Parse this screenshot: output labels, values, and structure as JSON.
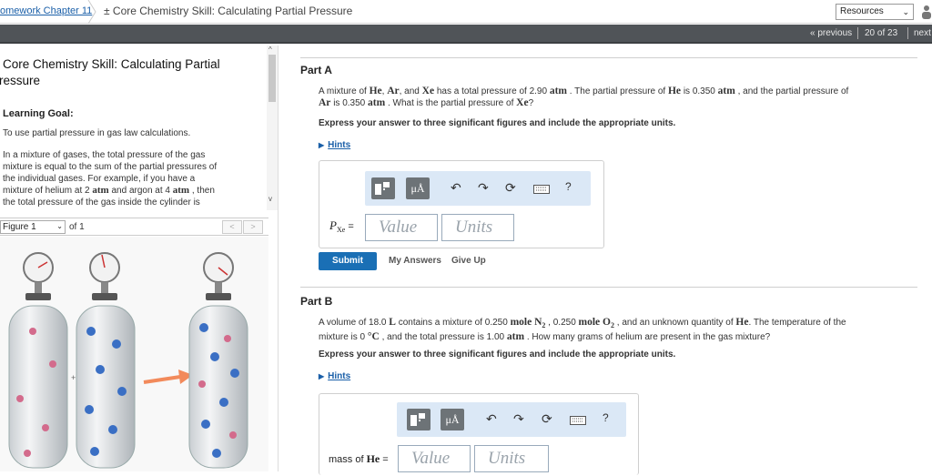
{
  "header": {
    "breadcrumb_link": "omework Chapter 11",
    "title": "± Core Chemistry Skill: Calculating Partial Pressure",
    "resources_label": "Resources"
  },
  "nav": {
    "previous_label": "« previous",
    "count": "20 of 23",
    "next_label": "next"
  },
  "intro": {
    "title_line1": "Core Chemistry Skill: Calculating Partial",
    "title_line2": "ressure",
    "goal_label": "Learning Goal:",
    "goal_text": "To use partial pressure in gas law calculations.",
    "para_line1": "In a mixture of gases, the total pressure of the gas",
    "para_line2": "mixture is equal to the sum of the partial pressures of",
    "para_line3": "the individual gases. For example, if you have a",
    "para_line4a": "mixture of helium at 2 ",
    "para_unit1": "atm",
    "para_line4b": " and argon at 4 ",
    "para_unit2": "atm",
    "para_line4c": " , then",
    "para_line5": "the total pressure of the gas inside the cylinder is"
  },
  "figure": {
    "select_value": "Figure 1",
    "of_text": "of 1",
    "prev_label": "<",
    "next_label": ">",
    "plus_sign": "+"
  },
  "partA": {
    "heading": "Part A",
    "q1": "A mixture of ",
    "he": "He",
    "c1": ", ",
    "ar": "Ar",
    "c2": ", and ",
    "xe": "Xe",
    "q2": " has a total pressure of 2.90 ",
    "atm1": "atm",
    "q3": " . The partial pressure of ",
    "he2": "He",
    "q4": " is 0.350 ",
    "atm2": "atm",
    "q5": " , and the partial pressure of",
    "ar2": "Ar",
    "q6": " is 0.350 ",
    "atm3": "atm",
    "q7": " . What is the partial pressure of ",
    "xe2": "Xe",
    "q8": "?",
    "instruction": "Express your answer to three significant figures and include the appropriate units.",
    "hints_label": "Hints",
    "field_label_prefix": "P",
    "field_label_sub": "Xe",
    "field_label_eq": " =",
    "value_placeholder": "Value",
    "units_placeholder": "Units",
    "submit_label": "Submit",
    "my_answers_label": "My Answers",
    "give_up_label": "Give Up"
  },
  "partB": {
    "heading": "Part B",
    "q1": "A volume of 18.0 ",
    "L": "L",
    "q2": " contains a mixture of 0.250 ",
    "mole1": "mole N",
    "sub2a": "2",
    "q3": " , 0.250 ",
    "mole2": "mole O",
    "sub2b": "2",
    "q4": " , and an unknown quantity of ",
    "he": "He",
    "q5": ". The temperature of the",
    "q6": "mixture is 0 ",
    "deg": "°C",
    "q7": " , and the total pressure is 1.00 ",
    "atm": "atm",
    "q8": " . How many grams of helium are present in the gas mixture?",
    "instruction": "Express your answer to three significant figures and include the appropriate units.",
    "hints_label": "Hints",
    "field_label": "mass of ",
    "field_he": "He",
    "field_eq": " =",
    "value_placeholder": "Value",
    "units_placeholder": "Units"
  },
  "toolbar": {
    "mu_label": "μÅ",
    "help_label": "?"
  },
  "icons": [
    "templates-icon",
    "units-icon",
    "undo-icon",
    "redo-icon",
    "reset-icon",
    "keyboard-icon",
    "help-icon",
    "user-icon"
  ]
}
